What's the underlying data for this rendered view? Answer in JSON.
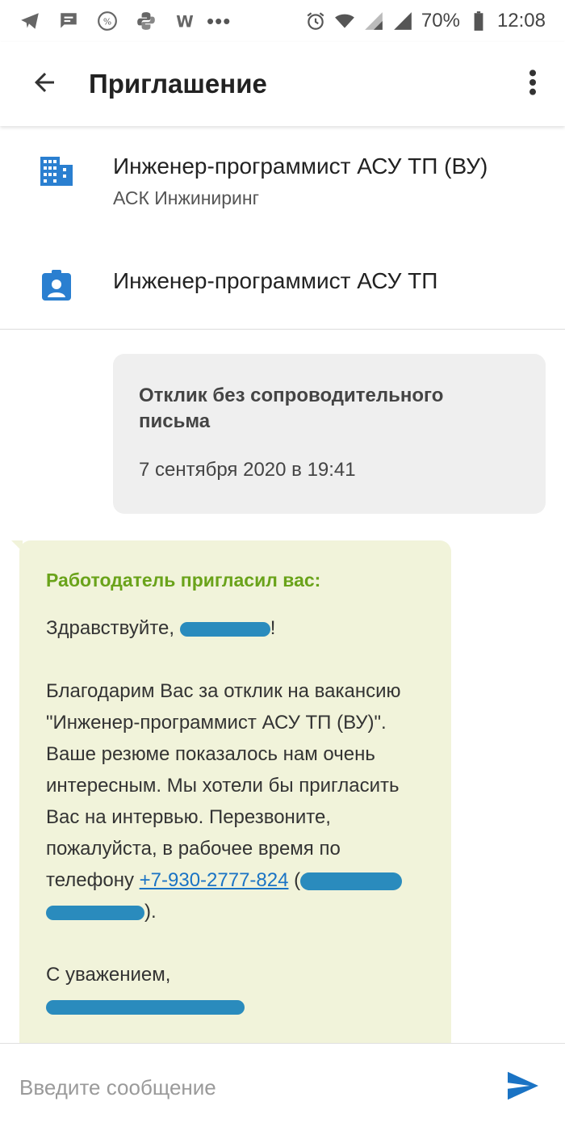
{
  "status_bar": {
    "battery": "70%",
    "time": "12:08",
    "more": "•••"
  },
  "app_bar": {
    "title": "Приглашение"
  },
  "vacancy": {
    "title": "Инженер-программист АСУ ТП (ВУ)",
    "company": "АСК Инжиниринг"
  },
  "resume": {
    "title": "Инженер-программист АСУ ТП"
  },
  "outgoing": {
    "text": "Отклик без сопроводительного письма",
    "date": "7 сентября 2020 в 19:41"
  },
  "incoming": {
    "header": "Работодатель пригласил вас:",
    "greeting_start": "Здравствуйте, ",
    "greeting_end": "!",
    "body": "Благодарим Вас за отклик на вакансию \"Инженер-программист АСУ ТП (ВУ)\". Ваше резюме показалось нам очень интересным. Мы хотели бы пригласить Вас на интервью. Перезвоните, пожалуйста, в рабочее время по телефону ",
    "phone": "+7-930-2777-824",
    "after_phone": " (",
    "closing_paren": ").",
    "regards": "С уважением,"
  },
  "input": {
    "placeholder": "Введите сообщение"
  },
  "colors": {
    "accent": "#1a73c4",
    "header_green": "#6aa31a",
    "bubble_in": "#f1f3da",
    "bubble_out": "#efefef",
    "redaction": "#2a8bbd"
  }
}
